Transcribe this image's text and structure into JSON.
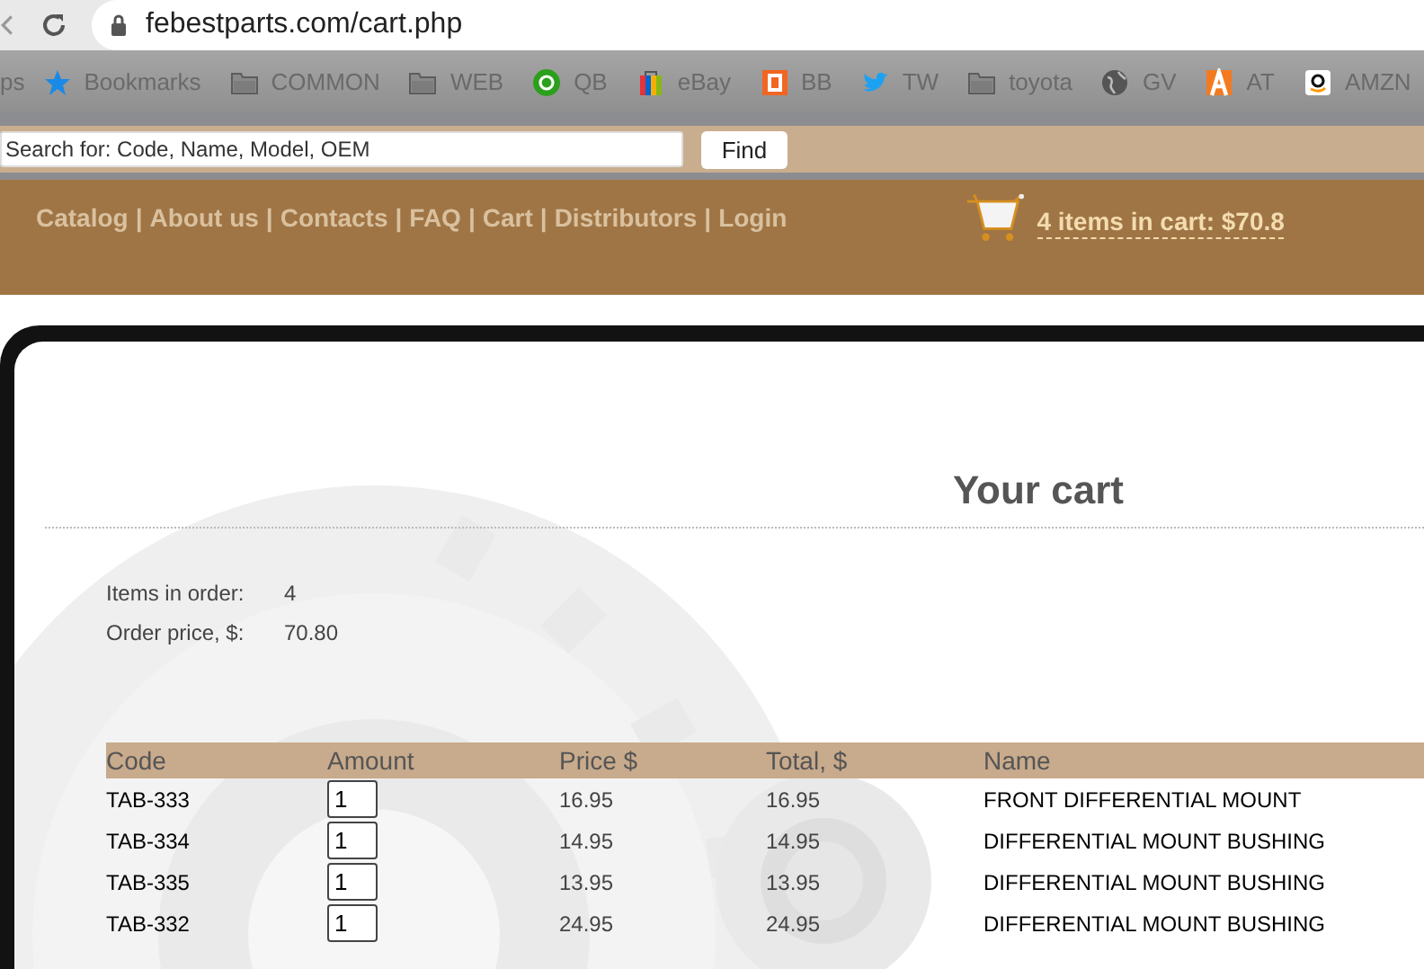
{
  "browser": {
    "url": "febestparts.com/cart.php"
  },
  "bookmarks": [
    {
      "label": "ps",
      "kind": "none"
    },
    {
      "label": "Bookmarks",
      "kind": "star"
    },
    {
      "label": "COMMON",
      "kind": "folder"
    },
    {
      "label": "WEB",
      "kind": "folder"
    },
    {
      "label": "QB",
      "kind": "qb"
    },
    {
      "label": "eBay",
      "kind": "bag"
    },
    {
      "label": "BB",
      "kind": "bb"
    },
    {
      "label": "TW",
      "kind": "bird"
    },
    {
      "label": "toyota",
      "kind": "folder"
    },
    {
      "label": "GV",
      "kind": "globe"
    },
    {
      "label": "AT",
      "kind": "at"
    },
    {
      "label": "AMZN",
      "kind": "amazon"
    }
  ],
  "search": {
    "placeholder": "Search for: Code, Name, Model, OEM",
    "button": "Find"
  },
  "nav": {
    "separator": "|",
    "links": [
      "Catalog",
      "About us",
      "Contacts",
      "FAQ",
      "Cart",
      "Distributors",
      "Login"
    ],
    "cart": "4 items in cart: $70.8"
  },
  "page": {
    "title": "Your cart",
    "summary": [
      {
        "label": "Items in order:",
        "value": "4"
      },
      {
        "label": "Order price, $:",
        "value": "70.80"
      }
    ],
    "table": {
      "columns": [
        "Code",
        "Amount",
        "Price $",
        "Total, $",
        "Name"
      ],
      "rows": [
        {
          "code": "TAB-333",
          "amount": "1",
          "price": "16.95",
          "total": "16.95",
          "name": "FRONT DIFFERENTIAL MOUNT"
        },
        {
          "code": "TAB-334",
          "amount": "1",
          "price": "14.95",
          "total": "14.95",
          "name": "DIFFERENTIAL MOUNT BUSHING"
        },
        {
          "code": "TAB-335",
          "amount": "1",
          "price": "13.95",
          "total": "13.95",
          "name": "DIFFERENTIAL MOUNT BUSHING"
        },
        {
          "code": "TAB-332",
          "amount": "1",
          "price": "24.95",
          "total": "24.95",
          "name": "DIFFERENTIAL MOUNT BUSHING"
        }
      ]
    }
  }
}
